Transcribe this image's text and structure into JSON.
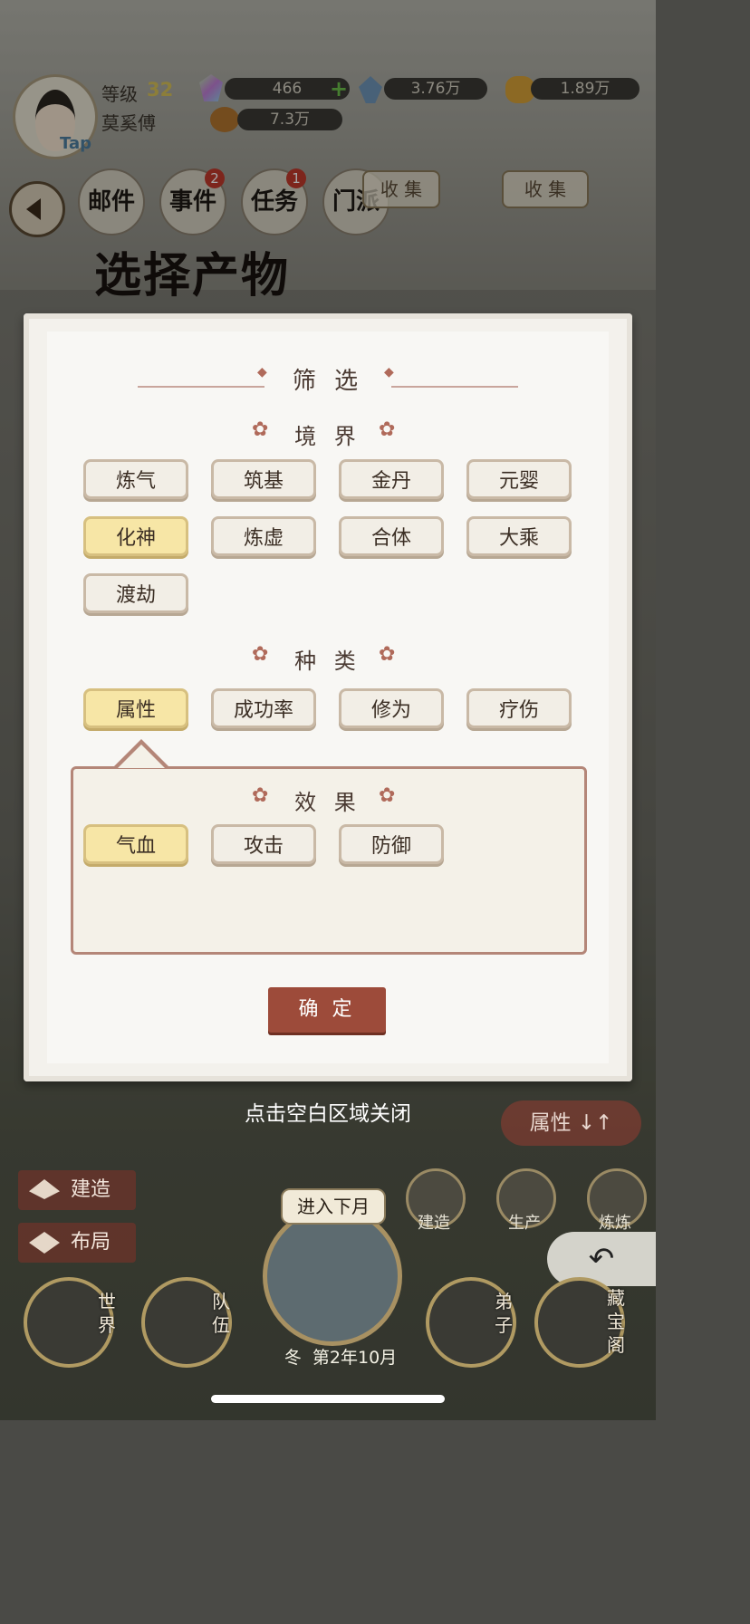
{
  "header": {
    "tap_label": "Tap",
    "level_label": "等级",
    "level_value": "32",
    "player_name": "莫奚傅",
    "resources": [
      "466",
      "3.76万",
      "1.89万",
      "7.3万"
    ]
  },
  "tabs": [
    {
      "label": "邮件",
      "badge": ""
    },
    {
      "label": "事件",
      "badge": "2"
    },
    {
      "label": "任务",
      "badge": "1"
    },
    {
      "label": "门派",
      "badge": ""
    }
  ],
  "scene": {
    "collect_1": "收 集",
    "collect_2": "收 集"
  },
  "page_title": "选择产物",
  "filter": {
    "title": "筛 选",
    "realm_title": "境 界",
    "realm_options": [
      {
        "label": "炼气",
        "selected": false
      },
      {
        "label": "筑基",
        "selected": false
      },
      {
        "label": "金丹",
        "selected": false
      },
      {
        "label": "元婴",
        "selected": false
      },
      {
        "label": "化神",
        "selected": true
      },
      {
        "label": "炼虚",
        "selected": false
      },
      {
        "label": "合体",
        "selected": false
      },
      {
        "label": "大乘",
        "selected": false
      },
      {
        "label": "渡劫",
        "selected": false
      }
    ],
    "type_title": "种 类",
    "type_options": [
      {
        "label": "属性",
        "selected": true
      },
      {
        "label": "成功率",
        "selected": false
      },
      {
        "label": "修为",
        "selected": false
      },
      {
        "label": "疗伤",
        "selected": false
      }
    ],
    "effect_title": "效 果",
    "effect_options": [
      {
        "label": "气血",
        "selected": true
      },
      {
        "label": "攻击",
        "selected": false
      },
      {
        "label": "防御",
        "selected": false
      }
    ],
    "confirm_label": "确 定"
  },
  "close_hint": "点击空白区域关闭",
  "sort_button": "属性 ↓↑",
  "bottom": {
    "build_label": "建造",
    "layout_label": "布局",
    "enter_next_month": "进入下月",
    "season": "冬",
    "date": "第2年10月",
    "side_buttons": [
      "建造",
      "生产",
      "炼炼"
    ],
    "nav": [
      "世界",
      "队伍",
      "弟子",
      "藏宝阁"
    ]
  }
}
